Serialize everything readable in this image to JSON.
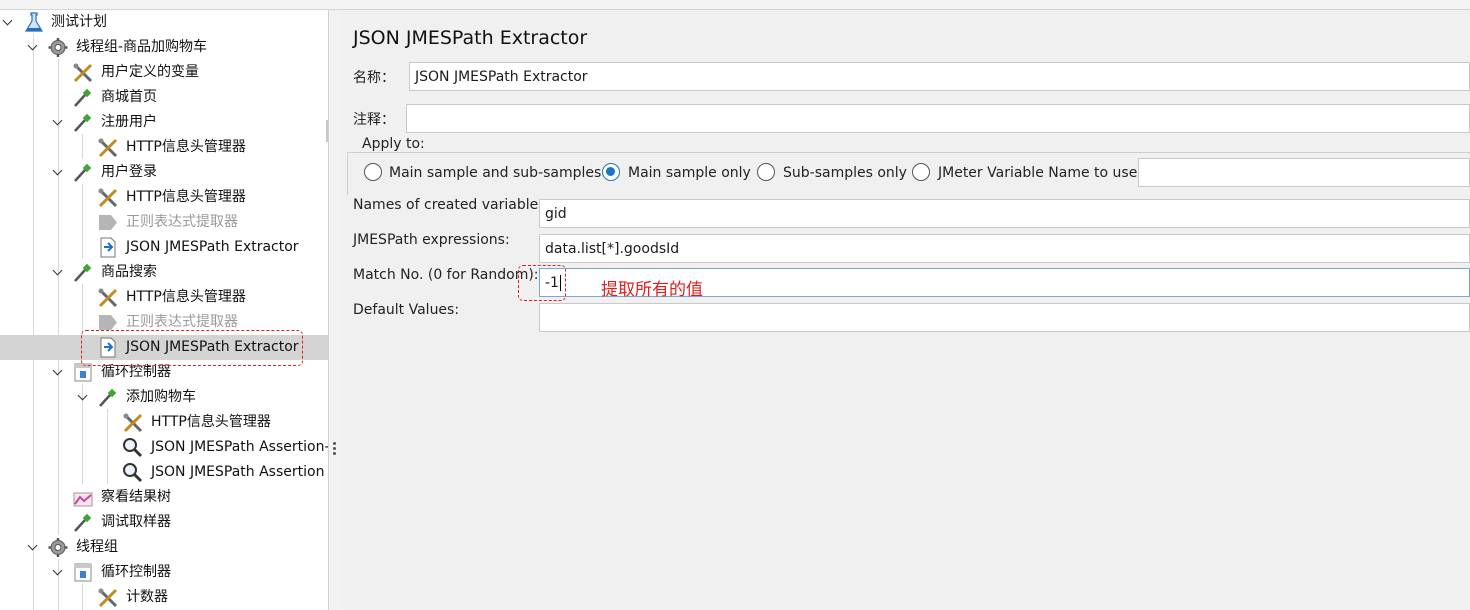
{
  "tree": {
    "items": [
      {
        "label": "测试计划",
        "icon": "test-plan-icon",
        "level": 0,
        "expanded": true
      },
      {
        "label": "线程组-商品加购物车",
        "icon": "gear-icon",
        "level": 1,
        "expanded": true
      },
      {
        "label": "用户定义的变量",
        "icon": "config-tools-icon",
        "level": 2
      },
      {
        "label": "商城首页",
        "icon": "sampler-pipette-icon",
        "level": 2
      },
      {
        "label": "注册用户",
        "icon": "sampler-pipette-icon",
        "level": 2,
        "expanded": true
      },
      {
        "label": "HTTP信息头管理器",
        "icon": "config-tools-icon",
        "level": 3
      },
      {
        "label": "用户登录",
        "icon": "sampler-pipette-icon",
        "level": 2,
        "expanded": true
      },
      {
        "label": "HTTP信息头管理器",
        "icon": "config-tools-icon",
        "level": 3
      },
      {
        "label": "正则表达式提取器",
        "icon": "regex-extractor-icon",
        "level": 3,
        "disabled": true
      },
      {
        "label": "JSON JMESPath Extractor",
        "icon": "json-extractor-icon",
        "level": 3
      },
      {
        "label": "商品搜索",
        "icon": "sampler-pipette-icon",
        "level": 2,
        "expanded": true
      },
      {
        "label": "HTTP信息头管理器",
        "icon": "config-tools-icon",
        "level": 3
      },
      {
        "label": "正则表达式提取器",
        "icon": "regex-extractor-icon",
        "level": 3,
        "disabled": true
      },
      {
        "label": "JSON JMESPath Extractor",
        "icon": "json-extractor-icon",
        "level": 3,
        "selected": true
      },
      {
        "label": "循环控制器",
        "icon": "loop-controller-icon",
        "level": 2,
        "expanded": true
      },
      {
        "label": "添加购物车",
        "icon": "sampler-pipette-icon",
        "level": 3,
        "expanded": true
      },
      {
        "label": "HTTP信息头管理器",
        "icon": "config-tools-icon",
        "level": 4
      },
      {
        "label": "JSON JMESPath Assertion-i",
        "icon": "assertion-magnifier-icon",
        "level": 4
      },
      {
        "label": "JSON JMESPath Assertion",
        "icon": "assertion-magnifier-icon",
        "level": 4
      },
      {
        "label": "察看结果树",
        "icon": "listener-chart-icon",
        "level": 2
      },
      {
        "label": "调试取样器",
        "icon": "sampler-pipette-icon",
        "level": 2
      },
      {
        "label": "线程组",
        "icon": "gear-icon",
        "level": 1,
        "expanded": true
      },
      {
        "label": "循环控制器",
        "icon": "loop-controller-icon",
        "level": 2,
        "expanded": true
      },
      {
        "label": "计数器",
        "icon": "config-tools-icon",
        "level": 3
      }
    ]
  },
  "panel": {
    "title": "JSON JMESPath Extractor",
    "name_label": "名称：",
    "name_value": "JSON JMESPath Extractor",
    "comment_label": "注释：",
    "comment_value": "",
    "apply_to": {
      "legend": "Apply to:",
      "options": [
        {
          "label": "Main sample and sub-samples",
          "selected": false
        },
        {
          "label": "Main sample only",
          "selected": true
        },
        {
          "label": "Sub-samples only",
          "selected": false
        },
        {
          "label": "JMeter Variable Name to use",
          "selected": false
        }
      ],
      "variable_value": ""
    },
    "fields": [
      {
        "label": "Names of created variables:",
        "value": "gid"
      },
      {
        "label": "JMESPath expressions:",
        "value": "data.list[*].goodsId"
      },
      {
        "label": "Match No. (0 for Random):",
        "value": "-1"
      },
      {
        "label": "Default Values:",
        "value": ""
      }
    ],
    "annotation": "提取所有的值"
  },
  "colors": {
    "accent": "#1a73c9",
    "annotation": "#e02020",
    "selection": "#d4d4d4",
    "panel_bg": "#f0f0f0"
  }
}
